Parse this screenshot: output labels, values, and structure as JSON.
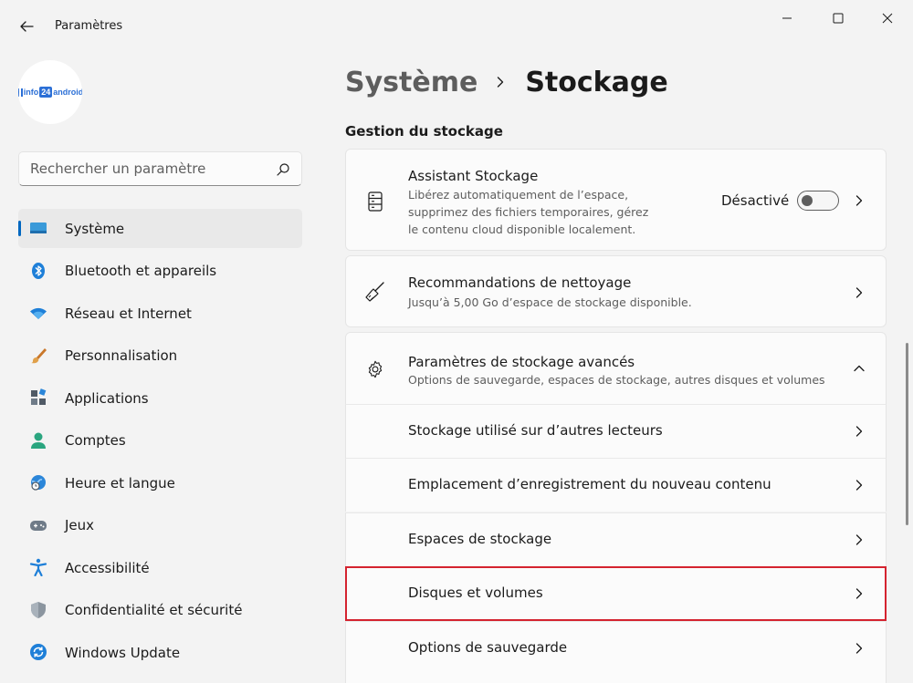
{
  "window": {
    "title": "Paramètres"
  },
  "profile": {
    "logo_part1": "info",
    "logo_part2": "24",
    "logo_part3": "android"
  },
  "search": {
    "placeholder": "Rechercher un paramètre"
  },
  "sidebar": {
    "items": [
      {
        "label": "Système",
        "icon": "system-display-icon",
        "active": true
      },
      {
        "label": "Bluetooth et appareils",
        "icon": "bluetooth-icon"
      },
      {
        "label": "Réseau et Internet",
        "icon": "wifi-icon"
      },
      {
        "label": "Personnalisation",
        "icon": "brush-icon"
      },
      {
        "label": "Applications",
        "icon": "apps-icon"
      },
      {
        "label": "Comptes",
        "icon": "person-icon"
      },
      {
        "label": "Heure et langue",
        "icon": "globe-clock-icon"
      },
      {
        "label": "Jeux",
        "icon": "gamepad-icon"
      },
      {
        "label": "Accessibilité",
        "icon": "accessibility-icon"
      },
      {
        "label": "Confidentialité et sécurité",
        "icon": "shield-icon"
      },
      {
        "label": "Windows Update",
        "icon": "update-icon"
      }
    ]
  },
  "breadcrumb": {
    "parent": "Système",
    "current": "Stockage"
  },
  "section": {
    "title": "Gestion du stockage"
  },
  "cards": {
    "assistant": {
      "title": "Assistant Stockage",
      "desc_line1": "Libérez automatiquement de l’espace,",
      "desc_line2": "supprimez des fichiers temporaires, gérez",
      "desc_line3": "le contenu cloud disponible localement.",
      "toggle_label": "Désactivé",
      "toggle_on": false
    },
    "cleanup": {
      "title": "Recommandations de nettoyage",
      "desc": "Jusqu’à 5,00 Go d’espace de stockage disponible."
    },
    "advanced": {
      "title": "Paramètres de stockage avancés",
      "desc": "Options de sauvegarde, espaces de stockage, autres disques et volumes",
      "expanded": true,
      "sub_items": [
        "Stockage utilisé sur d’autres lecteurs",
        "Emplacement d’enregistrement du nouveau contenu",
        "Espaces de stockage",
        "Disques et volumes",
        "Options de sauvegarde"
      ]
    }
  },
  "colors": {
    "accent": "#0067c0",
    "highlight": "#d4232f",
    "background": "#f3f3f3",
    "card": "#fbfbfb"
  }
}
